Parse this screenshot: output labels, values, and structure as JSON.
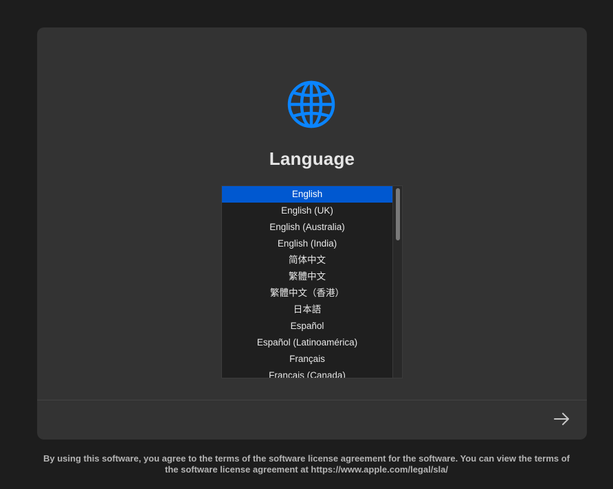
{
  "language_screen": {
    "title": "Language",
    "languages": [
      {
        "label": "English",
        "selected": true
      },
      {
        "label": "English (UK)",
        "selected": false
      },
      {
        "label": "English (Australia)",
        "selected": false
      },
      {
        "label": "English (India)",
        "selected": false
      },
      {
        "label": "简体中文",
        "selected": false
      },
      {
        "label": "繁體中文",
        "selected": false
      },
      {
        "label": "繁體中文（香港）",
        "selected": false
      },
      {
        "label": "日本語",
        "selected": false
      },
      {
        "label": "Español",
        "selected": false
      },
      {
        "label": "Español (Latinoamérica)",
        "selected": false
      },
      {
        "label": "Français",
        "selected": false
      },
      {
        "label": "Français (Canada)",
        "selected": false
      }
    ],
    "license_text": "By using this software, you agree to the terms of the software license agreement for the software. You can view the terms of the software license agreement at https://www.apple.com/legal/sla/"
  },
  "icons": {
    "globe": "globe-icon",
    "next": "arrow-right-icon"
  },
  "colors": {
    "accent": "#0a84ff",
    "selection": "#0058d0",
    "background": "#1d1d1d",
    "panel": "#333333"
  }
}
